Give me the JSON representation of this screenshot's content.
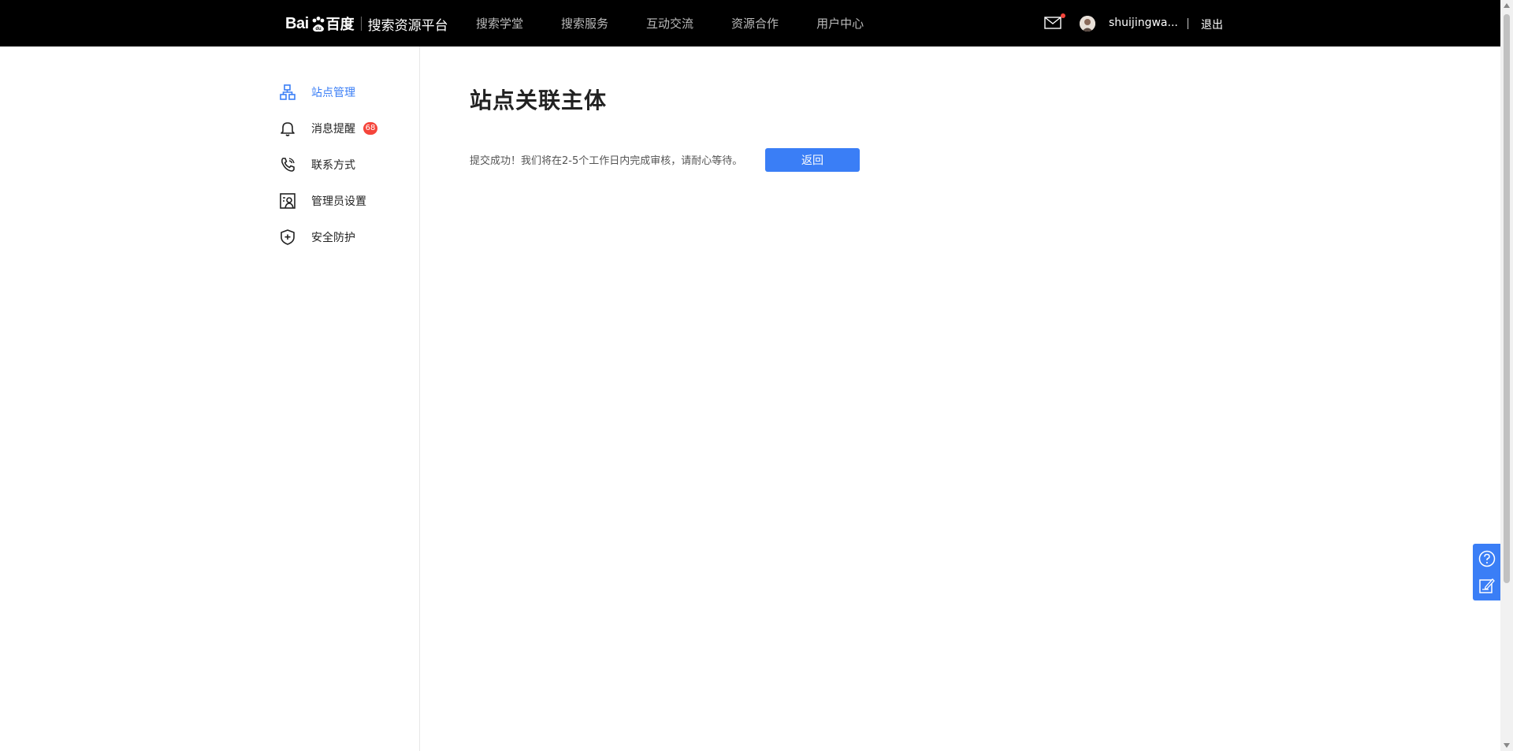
{
  "header": {
    "logo_text": "Bai",
    "logo_du": "百度",
    "platform": "搜索资源平台",
    "nav": [
      "搜索学堂",
      "搜索服务",
      "互动交流",
      "资源合作",
      "用户中心"
    ],
    "username": "shuijingwa...",
    "logout": "退出"
  },
  "sidebar": {
    "items": [
      {
        "label": "站点管理",
        "icon": "sitemap-icon"
      },
      {
        "label": "消息提醒",
        "icon": "bell-icon",
        "badge": "68"
      },
      {
        "label": "联系方式",
        "icon": "phone-icon"
      },
      {
        "label": "管理员设置",
        "icon": "admin-icon"
      },
      {
        "label": "安全防护",
        "icon": "shield-icon"
      }
    ]
  },
  "main": {
    "title": "站点关联主体",
    "message": "提交成功！我们将在2-5个工作日内完成审核，请耐心等待。",
    "back_button": "返回"
  },
  "colors": {
    "accent": "#3a7ef6",
    "badge": "#f5453b",
    "topbar": "#000000"
  }
}
